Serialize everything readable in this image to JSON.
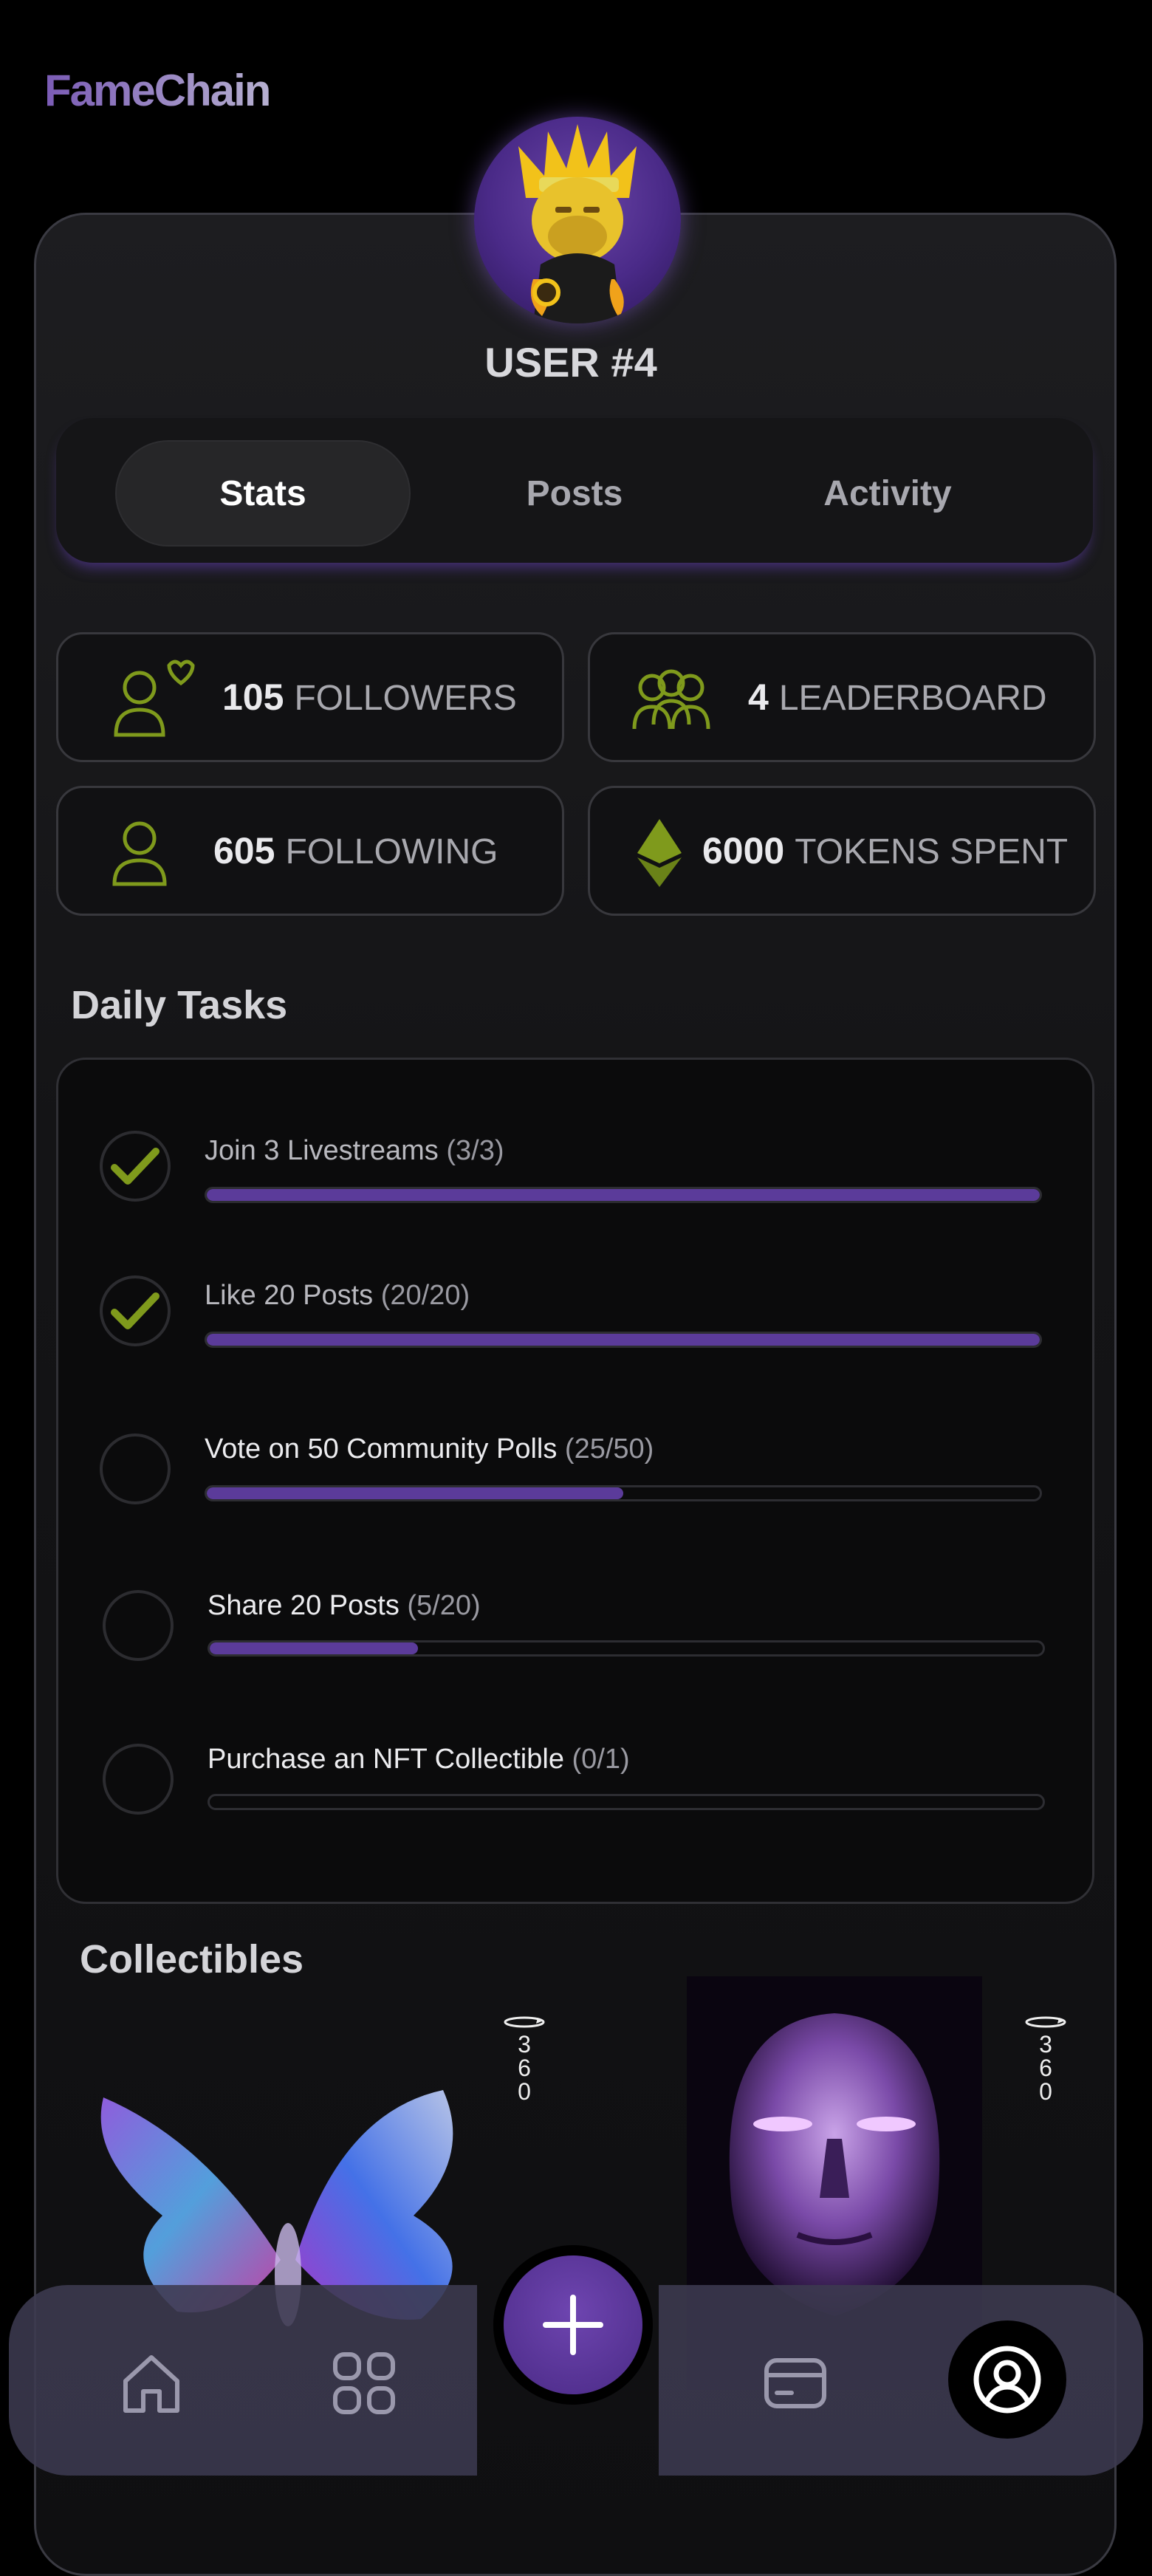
{
  "app": {
    "name": "FameChain"
  },
  "profile": {
    "username": "USER #4"
  },
  "tabs": [
    {
      "label": "Stats",
      "active": true
    },
    {
      "label": "Posts",
      "active": false
    },
    {
      "label": "Activity",
      "active": false
    }
  ],
  "stats": [
    {
      "value": "105",
      "label": "FOLLOWERS",
      "icon": "followers-heart-icon"
    },
    {
      "value": "4",
      "label": "LEADERBOARD",
      "icon": "group-icon"
    },
    {
      "value": "605",
      "label": "FOLLOWING",
      "icon": "user-icon"
    },
    {
      "value": "6000",
      "label": "TOKENS SPENT",
      "icon": "ethereum-icon"
    }
  ],
  "daily_tasks": {
    "title": "Daily Tasks",
    "items": [
      {
        "label": "Join 3 Livestreams",
        "count": "(3/3)",
        "progress": 1.0,
        "done": true
      },
      {
        "label": "Like 20 Posts",
        "count": "(20/20)",
        "progress": 1.0,
        "done": true
      },
      {
        "label": "Vote on 50 Community Polls",
        "count": "(25/50)",
        "progress": 0.5,
        "done": false
      },
      {
        "label": "Share 20 Posts",
        "count": "(5/20)",
        "progress": 0.25,
        "done": false
      },
      {
        "label": "Purchase an NFT Collectible",
        "count": "(0/1)",
        "progress": 0.0,
        "done": false
      }
    ]
  },
  "collectibles": {
    "title": "Collectibles",
    "items": [
      {
        "name": "butterfly",
        "badge": "360"
      },
      {
        "name": "purple-head",
        "badge": "360"
      }
    ]
  },
  "nav": {
    "items": [
      "home-icon",
      "grid-icon",
      "plus-icon",
      "wallet-card-icon",
      "profile-icon"
    ],
    "active": "profile-icon"
  },
  "colors": {
    "accent": "#5b3b9a",
    "icon_green": "#7f9a1c",
    "nav_bg": "#3c3a50"
  }
}
